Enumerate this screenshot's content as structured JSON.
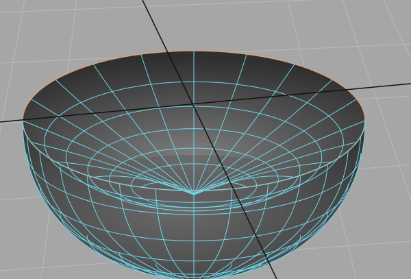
{
  "viewport": {
    "background_color": "#a6a6a6",
    "grid_line_color": "#bababa",
    "axis_line_color": "#111111"
  },
  "mesh": {
    "object_type": "hemisphere-bowl",
    "shading_dark": "#2b2b2b",
    "shading_mid": "#5e5e5e",
    "shading_light": "#8c8c8c",
    "wireframe_color": "#6fd6ea",
    "rim_edge_color": "#d9a07a",
    "selected": true
  }
}
